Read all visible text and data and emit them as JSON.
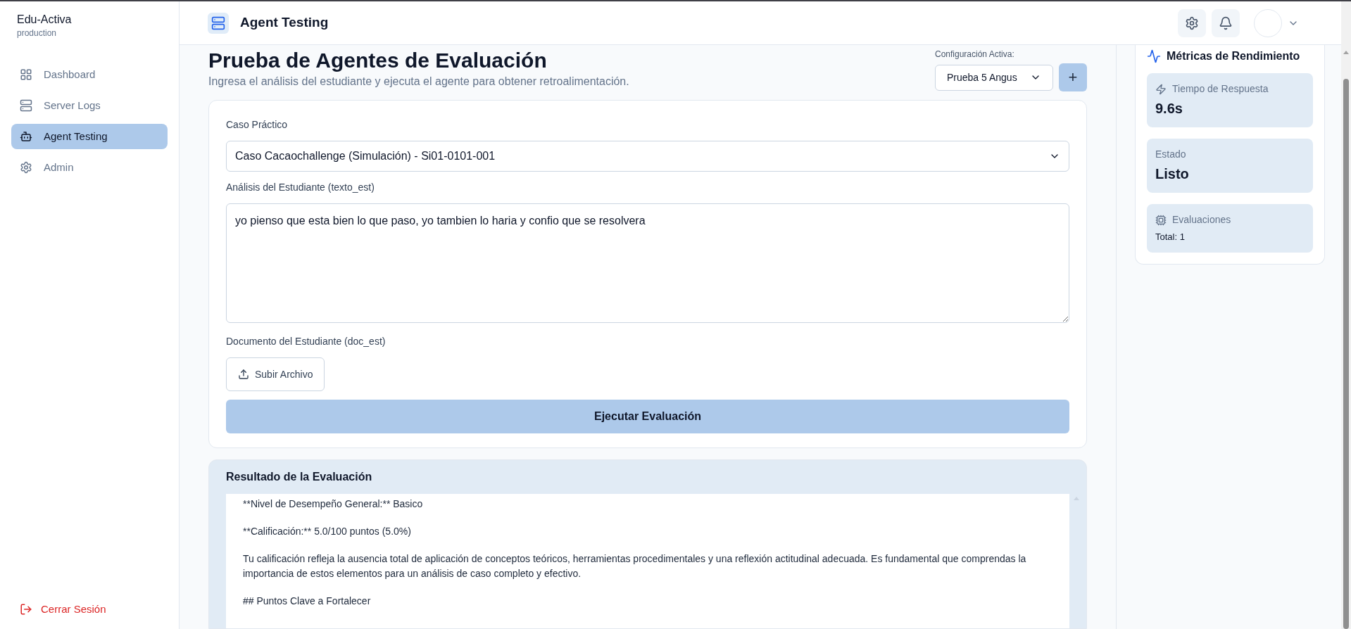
{
  "sidebar": {
    "brand": "Edu-Activa",
    "environment": "production",
    "items": [
      {
        "label": "Dashboard",
        "selected": false
      },
      {
        "label": "Server Logs",
        "selected": false
      },
      {
        "label": "Agent Testing",
        "selected": true
      },
      {
        "label": "Admin",
        "selected": false
      }
    ],
    "logout": "Cerrar Sesión"
  },
  "header": {
    "title": "Agent Testing"
  },
  "page": {
    "title": "Prueba de Agentes de Evaluación",
    "subtitle": "Ingresa el análisis del estudiante y ejecuta el agente para obtener retroalimentación.",
    "config_label": "Configuración Activa:",
    "config_value": "Prueba 5 Angus",
    "add_button": "+"
  },
  "form": {
    "case_label": "Caso Práctico",
    "case_value": "Caso Cacaochallenge (Simulación) - Si01-0101-001",
    "analysis_label": "Análisis del Estudiante (texto_est)",
    "analysis_value": "yo pienso que esta bien lo que paso, yo tambien lo haria y confio que se resolvera",
    "document_label": "Documento del Estudiante (doc_est)",
    "upload_button": "Subir Archivo",
    "run_button": "Ejecutar Evaluación"
  },
  "result": {
    "title": "Resultado de la Evaluación",
    "paragraphs": [
      "**Nivel de Desempeño General:** Basico",
      "**Calificación:** 5.0/100 puntos (5.0%)",
      "Tu calificación refleja la ausencia total de aplicación de conceptos teóricos, herramientas procedimentales y una reflexión actitudinal adecuada. Es fundamental que comprendas la importancia de estos elementos para un análisis de caso completo y efectivo.",
      "## Puntos Clave a Fortalecer"
    ]
  },
  "metrics": {
    "title": "Métricas de Rendimiento",
    "cards": [
      {
        "kind": "value",
        "label": "Tiempo de Respuesta",
        "value": "9.6s"
      },
      {
        "kind": "value",
        "label": "Estado",
        "value": "Listo"
      },
      {
        "kind": "total",
        "label": "Evaluaciones",
        "value": "Total: 1"
      }
    ]
  }
}
